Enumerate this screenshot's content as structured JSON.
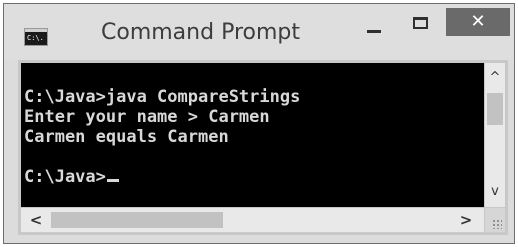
{
  "window": {
    "title": "Command Prompt",
    "app_icon": {
      "name": "cmd-icon",
      "text": "C:\\."
    },
    "controls": {
      "minimize": {
        "icon": "minimize-icon"
      },
      "maximize": {
        "icon": "maximize-icon"
      },
      "close": {
        "icon": "close-icon",
        "glyph": "✕"
      }
    }
  },
  "console": {
    "lines": [
      "C:\\Java>java CompareStrings",
      "Enter your name > Carmen",
      "Carmen equals Carmen",
      "",
      "C:\\Java>"
    ],
    "cursor": "underscore-cursor"
  },
  "scrollbars": {
    "vertical": {
      "up_glyph": "^",
      "down_glyph": "v"
    },
    "horizontal": {
      "left_glyph": "<",
      "right_glyph": ">"
    }
  },
  "colors": {
    "console_background": "#000000",
    "console_text": "#d8d8d8",
    "close_button": "#6a6a6a",
    "titlebar": "#dedede"
  }
}
